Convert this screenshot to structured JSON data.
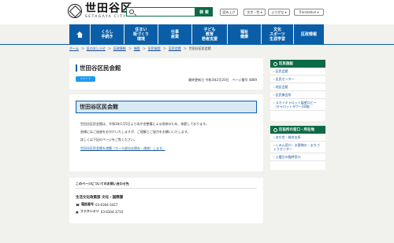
{
  "header": {
    "logo_jp": "世田谷区",
    "logo_en": "SETAGAYA CITY",
    "search_label": "検 索",
    "btn_read": "読み上げ",
    "btn_text": "文字・色 ▾",
    "btn_ruby": "ふりがな ▾",
    "btn_lang": "Translation ▾"
  },
  "nav": [
    {
      "line1": "くらし",
      "line2": "手続き"
    },
    {
      "line1": "住まい",
      "line2": "街づくり",
      "line3": "環境"
    },
    {
      "line1": "仕事",
      "line2": "産業"
    },
    {
      "line1": "子ども",
      "line2": "教育",
      "line3": "若者支援"
    },
    {
      "line1": "福祉",
      "line2": "健康"
    },
    {
      "line1": "文化",
      "line2": "スポーツ",
      "line3": "生涯学習"
    },
    {
      "line1": "区政情報"
    }
  ],
  "breadcrumb": [
    "ホーム",
    "区のおしらせ",
    "区政情報",
    "施設",
    "区民施設",
    "区民会館",
    "世田谷区民会館"
  ],
  "page": {
    "title": "世田谷区民会館",
    "tweet": "ツイート",
    "update": "最終更新日 令和3年2月20日　ページ番号 4889"
  },
  "content": {
    "subtitle": "世田谷区民会館",
    "line1": "世田谷区民会館は、令和3年1月5日より本庁舎整備による改修のため、休館しております。",
    "line2": "皆様にはご迷惑をおかけいたしますが、ご理解とご協力をお願いいたします。",
    "line3": "詳しくは下記のページをご覧ください。",
    "link": "世田谷区民会館を改築（ホール部分は保存・改修）します。"
  },
  "contact": {
    "heading": "このページについてのお問い合わせ先",
    "dept": "生活文化政策部 文化・国際課",
    "phone_label": "電話番号",
    "phone": "03-6304-3427",
    "fax_label": "ファクシミリ",
    "fax": "03-6304-3710"
  },
  "sidebar": {
    "section1_title": "区民施設",
    "section1_items": [
      "区民会館",
      "区民センター",
      "地区会館",
      "区民集会所",
      "スカイキャロット展望ロビー（キャロットタワー26階）"
    ],
    "section2_title": "区役所の窓口・所在地",
    "section2_items": [
      "本庁舎・総合支所",
      "くみん窓口・お客様の・まちづくりセンター",
      "土曜日の臨時窓口"
    ]
  }
}
